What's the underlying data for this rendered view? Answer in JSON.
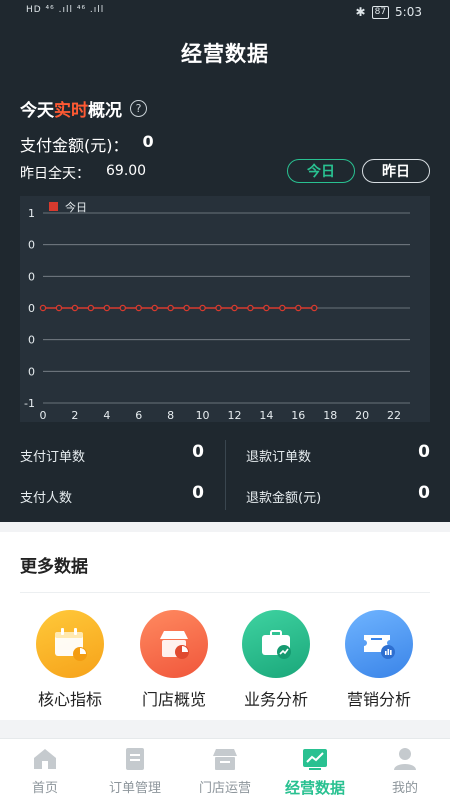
{
  "status_bar": {
    "left": "HD ⁴⁶ .ıll ⁴⁶ .ıll",
    "bluetooth": "✱",
    "battery": "87",
    "time": "5:03"
  },
  "header": {
    "title": "经营数据"
  },
  "overview": {
    "title_prefix": "今天",
    "title_accent": "实时",
    "title_suffix": "概况",
    "pay_label": "支付金额(元)：",
    "pay_value": "0",
    "yesterday_label": "昨日全天：",
    "yesterday_value": "69.00",
    "toggle_today": "今日",
    "toggle_yesterday": "昨日"
  },
  "colors": {
    "accent": "#ff5a33",
    "brand_green": "#29c191",
    "series_red": "#d83a2e",
    "dark_bg": "#1f282f"
  },
  "chart_data": {
    "type": "line",
    "legend": [
      "今日"
    ],
    "y_tick_labels": [
      "1",
      "0",
      "0",
      "0",
      "0",
      "0",
      "-1"
    ],
    "ylim": [
      -1,
      1
    ],
    "x_tick_labels": [
      "0",
      "2",
      "4",
      "6",
      "8",
      "10",
      "12",
      "14",
      "16",
      "18",
      "20",
      "22"
    ],
    "xlim": [
      0,
      23
    ],
    "series": [
      {
        "name": "今日",
        "x": [
          0,
          1,
          2,
          3,
          4,
          5,
          6,
          7,
          8,
          9,
          10,
          11,
          12,
          13,
          14,
          15,
          16,
          17
        ],
        "values": [
          0,
          0,
          0,
          0,
          0,
          0,
          0,
          0,
          0,
          0,
          0,
          0,
          0,
          0,
          0,
          0,
          0,
          0
        ]
      }
    ]
  },
  "stats": {
    "pay_orders_label": "支付订单数",
    "pay_orders_value": "0",
    "refund_orders_label": "退款订单数",
    "refund_orders_value": "0",
    "payers_label": "支付人数",
    "payers_value": "0",
    "refund_amount_label": "退款金额(元)",
    "refund_amount_value": "0"
  },
  "more_data": {
    "title": "更多数据",
    "items": [
      {
        "label": "核心指标",
        "icon": "calendar-chart-icon"
      },
      {
        "label": "门店概览",
        "icon": "store-pie-icon"
      },
      {
        "label": "业务分析",
        "icon": "briefcase-chart-icon"
      },
      {
        "label": "营销分析",
        "icon": "ticket-chart-icon"
      }
    ]
  },
  "tabbar": {
    "items": [
      {
        "label": "首页",
        "icon": "home-icon"
      },
      {
        "label": "订单管理",
        "icon": "order-icon"
      },
      {
        "label": "门店运营",
        "icon": "store-icon"
      },
      {
        "label": "经营数据",
        "icon": "chart-icon",
        "active": true
      },
      {
        "label": "我的",
        "icon": "user-icon"
      }
    ]
  }
}
